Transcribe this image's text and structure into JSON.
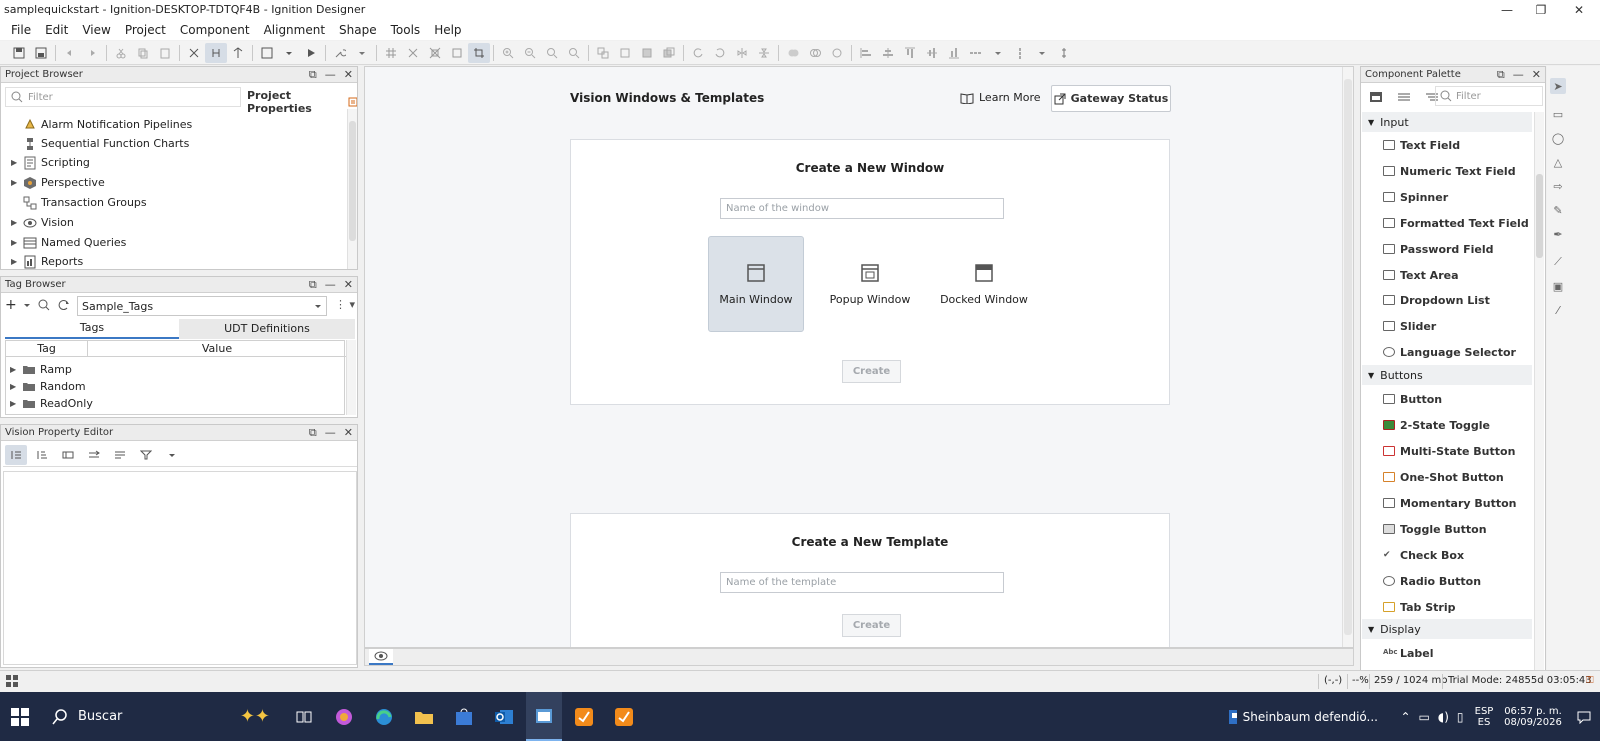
{
  "window": {
    "title": "samplequickstart - Ignition-DESKTOP-TDTQF4B - Ignition Designer",
    "minimize": "—",
    "maximize": "❐",
    "close": "✕"
  },
  "menu": [
    "File",
    "Edit",
    "View",
    "Project",
    "Component",
    "Alignment",
    "Shape",
    "Tools",
    "Help"
  ],
  "project_browser": {
    "title": "Project Browser",
    "filter_placeholder": "Filter",
    "properties_label": "Project Properties",
    "items": [
      {
        "label": "Alarm Notification Pipelines",
        "expandable": false
      },
      {
        "label": "Sequential Function Charts",
        "expandable": false
      },
      {
        "label": "Scripting",
        "expandable": true
      },
      {
        "label": "Perspective",
        "expandable": true
      },
      {
        "label": "Transaction Groups",
        "expandable": false
      },
      {
        "label": "Vision",
        "expandable": true
      },
      {
        "label": "Named Queries",
        "expandable": true
      },
      {
        "label": "Reports",
        "expandable": true
      }
    ]
  },
  "tag_browser": {
    "title": "Tag Browser",
    "provider": "Sample_Tags",
    "tabs": [
      "Tags",
      "UDT Definitions"
    ],
    "columns": [
      "Tag",
      "Value"
    ],
    "rows": [
      "Ramp",
      "Random",
      "ReadOnly"
    ]
  },
  "property_editor": {
    "title": "Vision Property Editor"
  },
  "workspace": {
    "heading": "Vision Windows & Templates",
    "learn_more": "Learn More",
    "gateway_status": "Gateway Status",
    "new_window": {
      "title": "Create a New Window",
      "placeholder": "Name of the window",
      "options": [
        "Main Window",
        "Popup Window",
        "Docked Window"
      ],
      "selected": "Main Window",
      "create": "Create"
    },
    "new_template": {
      "title": "Create a New Template",
      "placeholder": "Name of the template",
      "create": "Create"
    }
  },
  "palette": {
    "title": "Component Palette",
    "filter_placeholder": "Filter",
    "categories": [
      {
        "name": "Input",
        "items": [
          "Text Field",
          "Numeric Text Field",
          "Spinner",
          "Formatted Text Field",
          "Password Field",
          "Text Area",
          "Dropdown List",
          "Slider",
          "Language Selector"
        ]
      },
      {
        "name": "Buttons",
        "items": [
          "Button",
          "2-State Toggle",
          "Multi-State Button",
          "One-Shot Button",
          "Momentary Button",
          "Toggle Button",
          "Check Box",
          "Radio Button",
          "Tab Strip"
        ]
      },
      {
        "name": "Display",
        "items": [
          "Label"
        ]
      }
    ]
  },
  "statusbar": {
    "coords": "(-,-)",
    "zoom": "--%",
    "memory": "259 / 1024 mb",
    "trial": "Trial Mode: 24855d 03:05:43"
  },
  "taskbar": {
    "search_label": "Buscar",
    "news": "Sheinbaum defendió...",
    "lang_top": "ESP",
    "lang_bottom": "ES",
    "time": "06:57 p. m.",
    "date": "08/09/2026"
  },
  "colors": {
    "accent": "#3b78c4",
    "taskbar": "#1f2a44",
    "selected_option": "#dbe1e8"
  }
}
